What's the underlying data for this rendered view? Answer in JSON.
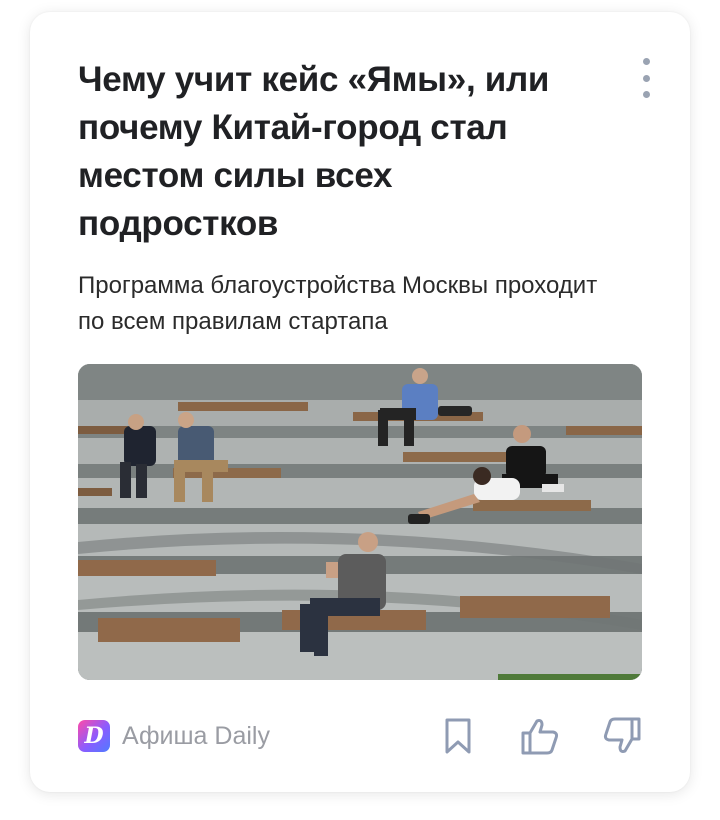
{
  "card": {
    "title": "Чему учит кейс «Ямы», или почему Китай-город стал местом силы всех подростков",
    "subtitle": "Программа благоустройства Москвы проходит по всем правилам стартапа",
    "image_icon": "photo-amphitheater-steps",
    "more_icon": "vertical-dots-icon"
  },
  "footer": {
    "source_logo_letter": "D",
    "source_name": "Афиша Daily",
    "bookmark_icon": "bookmark-icon",
    "like_icon": "thumbs-up-icon",
    "dislike_icon": "thumbs-down-icon"
  },
  "colors": {
    "title": "#202124",
    "muted": "#9a9ca3",
    "icon": "#8f9bb3",
    "logo_gradient": [
      "#ff4aa8",
      "#8a5cff",
      "#4f7bff"
    ]
  }
}
